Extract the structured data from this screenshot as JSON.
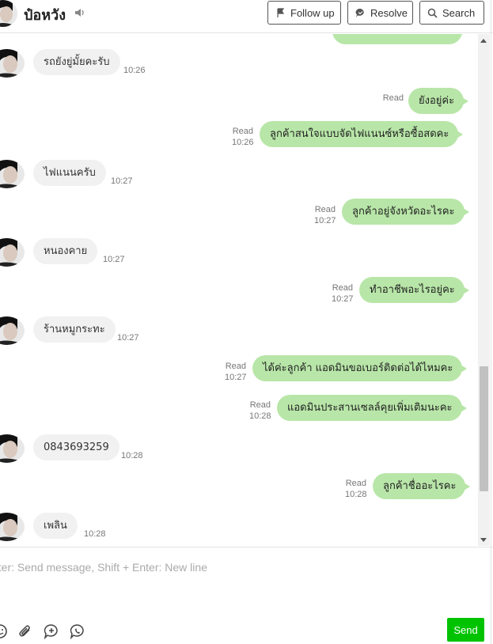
{
  "header": {
    "contact_name": "ป๋อหวัง",
    "follow_up_label": "Follow up",
    "resolve_label": "Resolve",
    "search_label": "Search"
  },
  "messages": [
    {
      "dir": "in",
      "text": "รถยังยู่มั้ยคะรับ",
      "time": "10:26"
    },
    {
      "dir": "out",
      "text": "ยังอยู่ค่ะ",
      "read": "Read",
      "time": ""
    },
    {
      "dir": "out",
      "text": "ลูกค้าสนใจแบบจัดไฟแนนซ์หรือซื้อสดคะ",
      "read": "Read",
      "time": "10:26"
    },
    {
      "dir": "in",
      "text": "ไฟแนนครับ",
      "time": "10:27"
    },
    {
      "dir": "out",
      "text": "ลูกค้าอยู่จังหวัดอะไรคะ",
      "read": "Read",
      "time": "10:27"
    },
    {
      "dir": "in",
      "text": "หนองคาย",
      "time": "10:27"
    },
    {
      "dir": "out",
      "text": "ทำอาชีพอะไรอยู่คะ",
      "read": "Read",
      "time": "10:27"
    },
    {
      "dir": "in",
      "text": "ร้านหมูกระทะ",
      "time": "10:27"
    },
    {
      "dir": "out",
      "text": "ได้ค่ะลูกค้า แอดมินขอเบอร์ติดต่อได้ไหมคะ",
      "read": "Read",
      "time": "10:27"
    },
    {
      "dir": "out",
      "text": "แอดมินประสานเซลล์คุยเพิ่มเติมนะคะ",
      "read": "Read",
      "time": "10:28"
    },
    {
      "dir": "in",
      "text": "0843693259",
      "time": "10:28"
    },
    {
      "dir": "out",
      "text": "ลูกค้าชื่ออะไรคะ",
      "read": "Read",
      "time": "10:28"
    },
    {
      "dir": "in",
      "text": "เพลิน",
      "time": "10:28"
    }
  ],
  "composer": {
    "placeholder": "nter: Send message, Shift + Enter: New line",
    "send_label": "Send"
  },
  "colors": {
    "outgoing_bubble": "#b8e6a8",
    "incoming_bubble": "#f1f1f1",
    "send_button": "#00c300"
  },
  "icons": [
    "mute-speaker-icon",
    "follow-up-flag-icon",
    "resolve-chat-icon",
    "search-icon",
    "emoji-icon",
    "attachment-icon",
    "add-chat-icon",
    "line-call-icon"
  ]
}
